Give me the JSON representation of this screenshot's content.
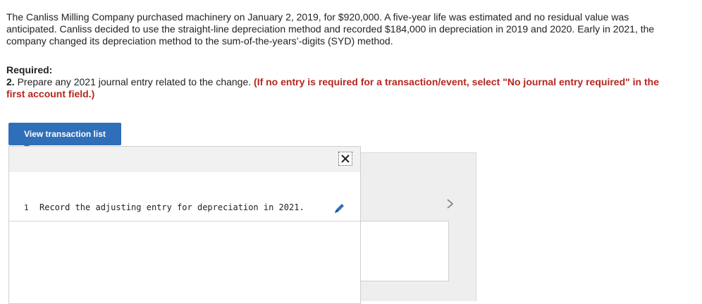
{
  "problem": {
    "text": "The Canliss Milling Company purchased machinery on January 2, 2019, for $920,000. A five-year life was estimated and no residual value was anticipated. Canliss decided to use the straight-line depreciation method and recorded $184,000 in depreciation in 2019 and 2020. Early in 2021, the company changed its depreciation method to the sum-of-the-years’-digits (SYD) method."
  },
  "required": {
    "heading": "Required:",
    "number": "2.",
    "question": " Prepare any 2021 journal entry related to the change. ",
    "hint": "(If no entry is required for a transaction/event, select \"No journal entry required\" in the first account field.)"
  },
  "actions": {
    "view_transaction_list": "View transaction list"
  },
  "transactions": [
    {
      "number": "1",
      "description": "Record the adjusting entry for depreciation in 2021."
    }
  ],
  "colors": {
    "accent": "#2f6fba",
    "hint": "#b5261e"
  }
}
